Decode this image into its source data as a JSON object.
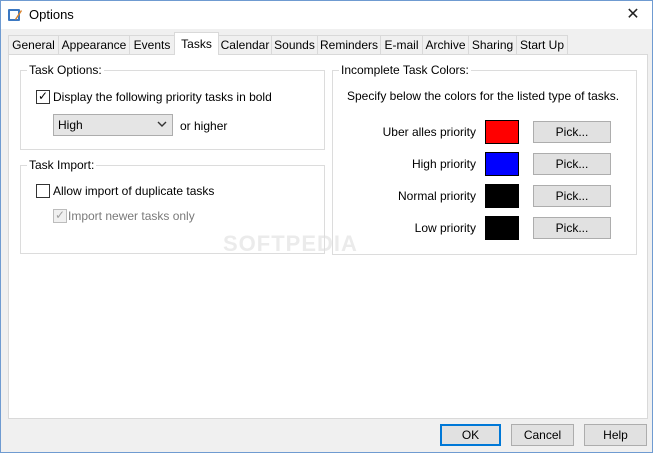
{
  "window": {
    "title": "Options",
    "icon": "app-icon",
    "close_glyph": "✕"
  },
  "tabs": [
    {
      "label": "General"
    },
    {
      "label": "Appearance"
    },
    {
      "label": "Events"
    },
    {
      "label": "Tasks",
      "active": true
    },
    {
      "label": "Calendar"
    },
    {
      "label": "Sounds"
    },
    {
      "label": "Reminders"
    },
    {
      "label": "E-mail"
    },
    {
      "label": "Archive"
    },
    {
      "label": "Sharing"
    },
    {
      "label": "Start Up"
    }
  ],
  "task_options": {
    "group_label": "Task Options:",
    "bold_checkbox": {
      "label": "Display the following priority tasks in bold",
      "checked": true
    },
    "priority_select": {
      "value": "High"
    },
    "suffix": "or higher"
  },
  "task_import": {
    "group_label": "Task Import:",
    "allow_duplicates": {
      "label": "Allow import of duplicate tasks",
      "checked": false
    },
    "import_newer": {
      "label": "Import newer tasks only",
      "checked": true,
      "disabled": true
    }
  },
  "incomplete_colors": {
    "group_label": "Incomplete Task Colors:",
    "description": "Specify below the colors for the listed type of tasks.",
    "rows": [
      {
        "label": "Uber alles priority",
        "color": "#ff0000",
        "button": "Pick..."
      },
      {
        "label": "High priority",
        "color": "#0000ff",
        "button": "Pick..."
      },
      {
        "label": "Normal priority",
        "color": "#000000",
        "button": "Pick..."
      },
      {
        "label": "Low priority",
        "color": "#000000",
        "button": "Pick..."
      }
    ]
  },
  "footer": {
    "ok": "OK",
    "cancel": "Cancel",
    "help": "Help"
  },
  "watermark": "SOFTPEDIA"
}
